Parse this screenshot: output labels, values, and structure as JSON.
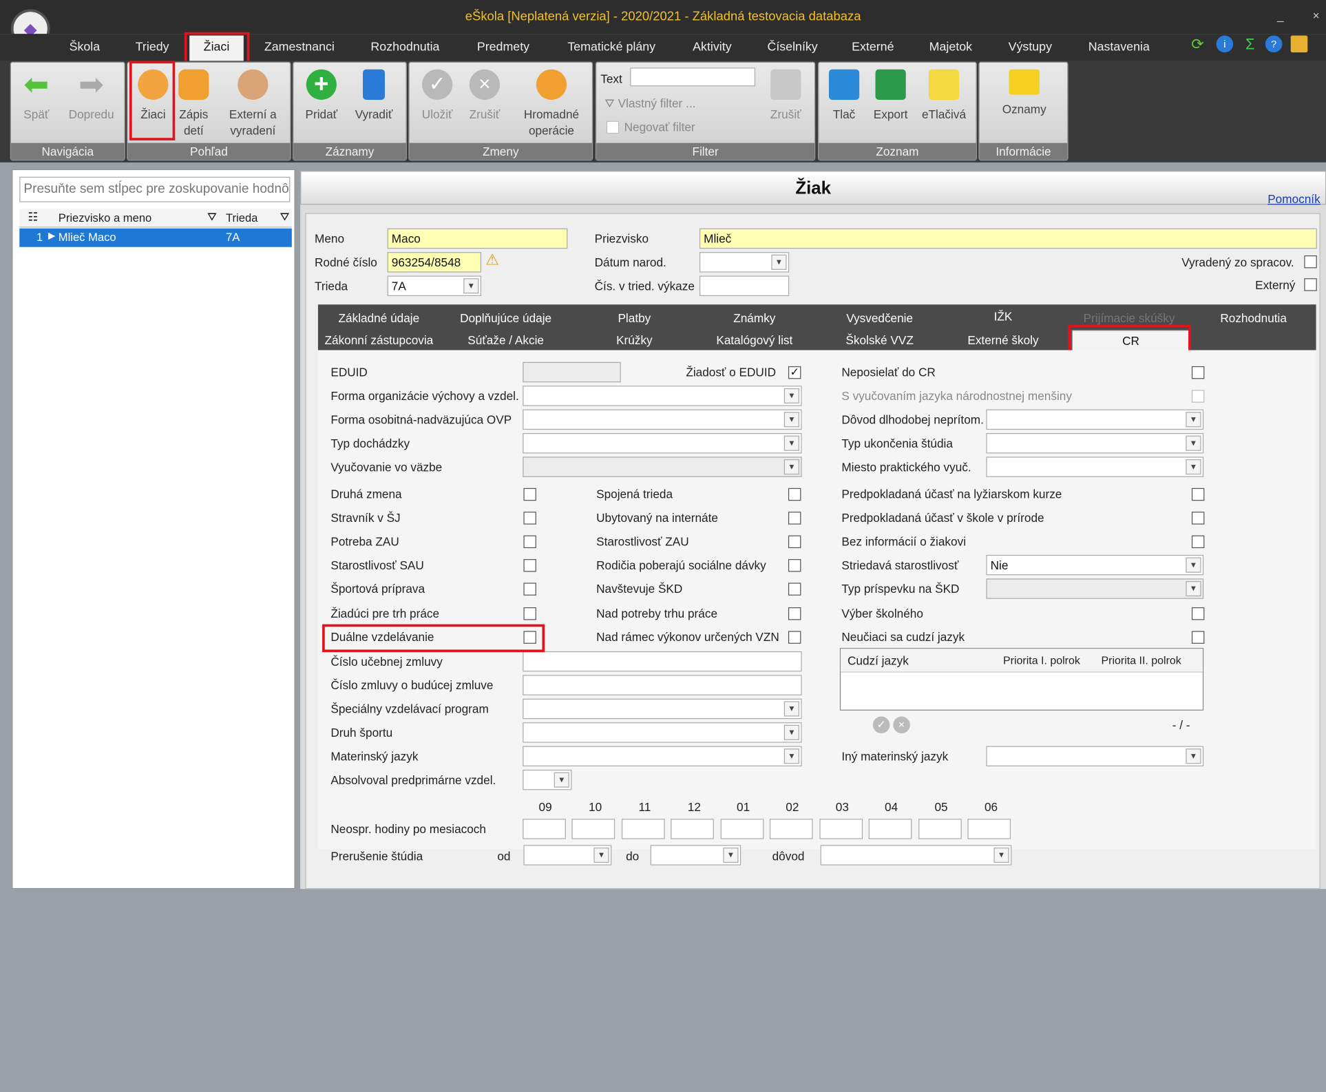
{
  "window": {
    "title": "eŠkola [Neplatená verzia] - 2020/2021 - Základná testovacia databaza",
    "minimize": "_",
    "close": "×"
  },
  "menu": [
    "Škola",
    "Triedy",
    "Žiaci",
    "Zamestnanci",
    "Rozhodnutia",
    "Predmety",
    "Tematické plány",
    "Aktivity",
    "Číselníky",
    "Externé",
    "Majetok",
    "Výstupy",
    "Nastavenia"
  ],
  "menu_active_index": 2,
  "toolbar_icons": [
    "refresh-icon",
    "info-icon",
    "sigma-icon",
    "help-icon",
    "printer-small-icon"
  ],
  "ribbon": {
    "navigacia": {
      "title": "Navigácia",
      "spat": "Späť",
      "dopredu": "Dopredu"
    },
    "pohlad": {
      "title": "Pohľad",
      "ziaci": "Žiaci",
      "zapis": "Zápis detí",
      "externi": "Externí a vyradení"
    },
    "zaznamy": {
      "title": "Záznamy",
      "pridat": "Pridať",
      "vyradit": "Vyradiť"
    },
    "zmeny": {
      "title": "Zmeny",
      "ulozit": "Uložiť",
      "zrusit": "Zrušiť",
      "hromadne": "Hromadné operácie"
    },
    "filter": {
      "title": "Filter",
      "text_label": "Text",
      "text_value": "",
      "vlastny": "Vlastný filter ...",
      "negovat": "Negovať filter",
      "zrusit": "Zrušiť"
    },
    "zoznam": {
      "title": "Zoznam",
      "tlac": "Tlač",
      "export": "Export",
      "etlaciva": "eTlačivá"
    },
    "informacie": {
      "title": "Informácie",
      "oznamy": "Oznamy"
    }
  },
  "left": {
    "group_placeholder": "Presuňte sem stĺpec pre zoskupovanie hodnôt",
    "columns": [
      "Priezvisko a meno",
      "Trieda"
    ],
    "rows": [
      {
        "num": "1",
        "name": "Mlieč Maco",
        "trieda": "7A"
      }
    ]
  },
  "student": {
    "title": "Žiak",
    "pomocnik": "Pomocník",
    "meno_label": "Meno",
    "meno": "Maco",
    "priezvisko_label": "Priezvisko",
    "priezvisko": "Mlieč",
    "rodne_label": "Rodné číslo",
    "rodne": "963254/8548",
    "datum_label": "Dátum narod.",
    "datum": "",
    "vyradeny_label": "Vyradený zo spracov.",
    "trieda_label": "Trieda",
    "trieda": "7A",
    "cis_label": "Čís. v tried. výkaze",
    "cis": "",
    "externy_label": "Externý"
  },
  "tabs_row1": [
    "Základné údaje",
    "Doplňujúce údaje",
    "Platby",
    "Známky",
    "Vysvedčenie",
    "IŽK",
    "Prijímacie skúšky",
    "Rozhodnutia"
  ],
  "tabs_row2": [
    "Zákonní zástupcovia",
    "Súťaže / Akcie",
    "Krúžky",
    "Katalógový list",
    "Školské VVZ",
    "Externé školy",
    "CR"
  ],
  "cr": {
    "eduid_label": "EDUID",
    "eduid": "",
    "ziadost_label": "Žiadosť o EDUID",
    "neposielat_label": "Neposielať do CR",
    "forma_org_label": "Forma organizácie výchovy a vzdel.",
    "forma_osob_label": "Forma osobitná-nadväzujúca OVP",
    "typ_doch_label": "Typ dochádzky",
    "vyuc_vazbe_label": "Vyučovanie vo väzbe",
    "s_vyuc_label": "S vyučovaním jazyka národnostnej menšiny",
    "dovod_label": "Dôvod dlhodobej neprítom.",
    "typ_ukon_label": "Typ ukončenia štúdia",
    "miesto_label": "Miesto praktického vyuč.",
    "chk_col1": [
      "Druhá zmena",
      "Stravník v ŠJ",
      "Potreba ZAU",
      "Starostlivosť SAU",
      "Športová príprava",
      "Žiadúci pre trh práce",
      "Duálne vzdelávanie"
    ],
    "chk_col2": [
      "Spojená trieda",
      "Ubytovaný na internáte",
      "Starostlivosť ZAU",
      "Rodičia poberajú sociálne dávky",
      "Navštevuje ŠKD",
      "Nad potreby trhu práce",
      "Nad rámec výkonov určených VZN"
    ],
    "chk_col3": [
      "Predpokladaná účasť na lyžiarskom kurze",
      "Predpokladaná účasť v škole v prírode",
      "Bez informácií o žiakovi"
    ],
    "striedava_label": "Striedavá starostlivosť",
    "striedava": "Nie",
    "typ_prisp_label": "Typ príspevku na ŠKD",
    "vyber_label": "Výber školného",
    "neuciaci_label": "Neučiaci sa cudzí jazyk",
    "jazyk_cols": [
      "Cudzí jazyk",
      "Priorita I. polrok",
      "Priorita II. polrok"
    ],
    "nav_counter": "- / -",
    "cislo_ucebnej_label": "Číslo učebnej zmluvy",
    "cislo_zmluvy_label": "Číslo zmluvy o budúcej zmluve",
    "specialny_label": "Špeciálny vzdelávací program",
    "druh_sportu_label": "Druh športu",
    "materinsky_label": "Materinský jazyk",
    "iny_materinsky_label": "Iný materinský jazyk",
    "absolvoval_label": "Absolvoval predprimárne vzdel.",
    "mesiace": [
      "09",
      "10",
      "11",
      "12",
      "01",
      "02",
      "03",
      "04",
      "05",
      "06"
    ],
    "neospr_label": "Neospr. hodiny po mesiacoch",
    "prerusenie_label": "Prerušenie štúdia",
    "od_label": "od",
    "do_label": "do",
    "dovod2_label": "dôvod"
  }
}
